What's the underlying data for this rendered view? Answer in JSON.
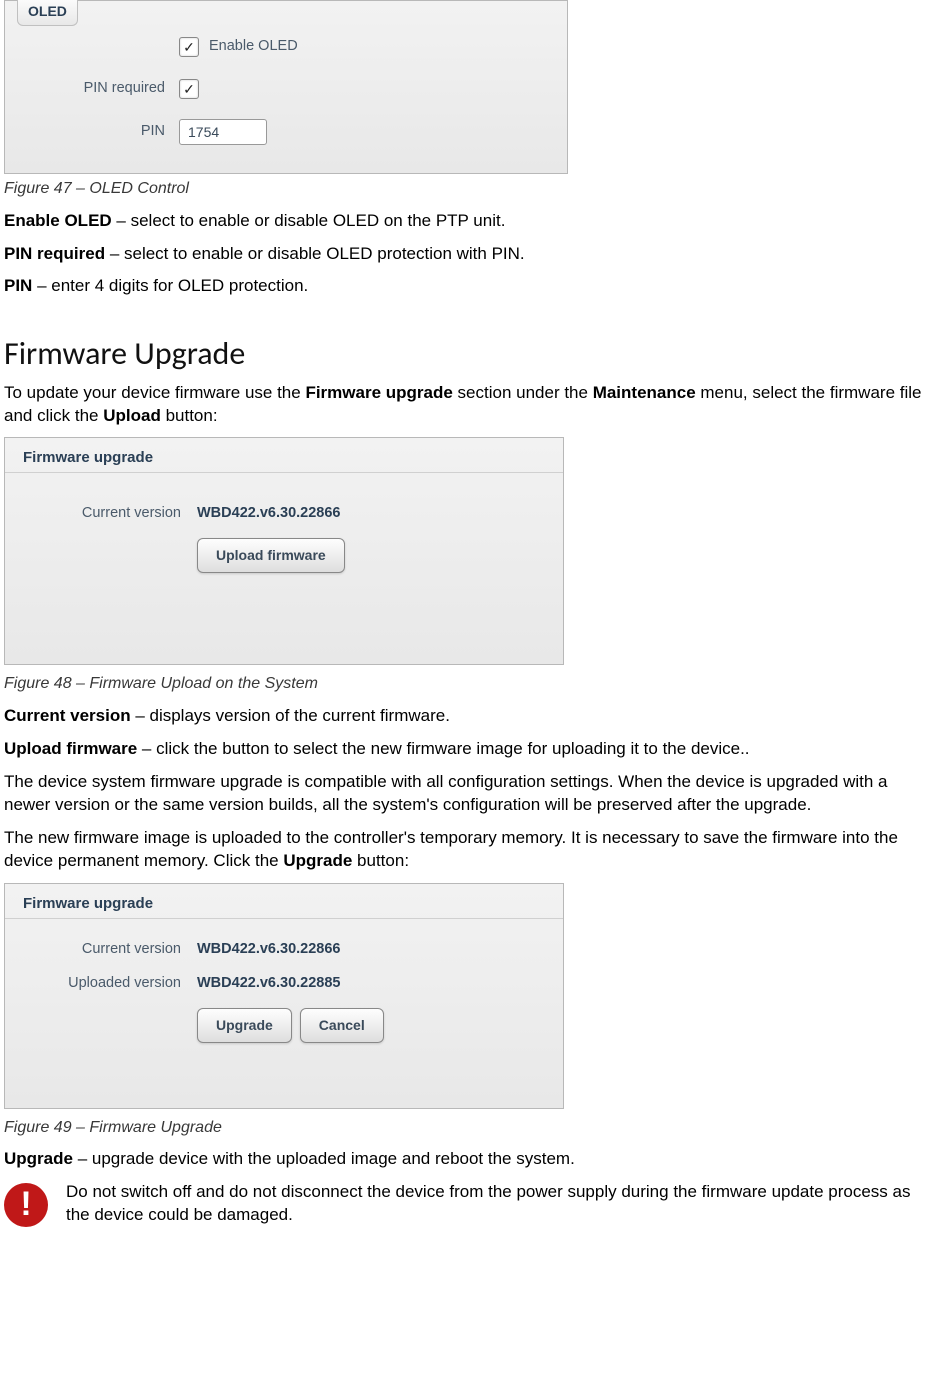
{
  "fig47": {
    "panel_title": "OLED",
    "enable_label": "Enable OLED",
    "pin_required_label": "PIN required",
    "pin_label": "PIN",
    "pin_value": "1754",
    "caption": "Figure 47 – OLED Control"
  },
  "def47": {
    "enable_bold": "Enable OLED",
    "enable_rest": " – select to enable or disable OLED on the PTP unit.",
    "pinreq_bold": "PIN required",
    "pinreq_rest": " – select to enable or disable OLED protection with PIN.",
    "pin_bold": "PIN",
    "pin_rest": " – enter 4 digits for OLED protection."
  },
  "heading_firmware": "Firmware Upgrade",
  "firmware_intro": {
    "t1": "To update your device firmware use the ",
    "b1": "Firmware upgrade",
    "t2": " section under the ",
    "b2": "Maintenance",
    "t3": " menu, select the firmware file and click the ",
    "b3": "Upload",
    "t4": " button:"
  },
  "fig48": {
    "panel_title": "Firmware upgrade",
    "current_label": "Current version",
    "current_value": "WBD422.v6.30.22866",
    "upload_button": "Upload firmware",
    "caption": "Figure 48 – Firmware Upload on the System"
  },
  "def48": {
    "cv_bold": "Current version",
    "cv_rest": " – displays version of the current firmware.",
    "uf_bold": "Upload firmware",
    "uf_rest": " – click the button to select the new firmware image for uploading it to the device..",
    "compat": "The device system firmware upgrade is compatible with all configuration settings. When the device is upgraded with a newer version or the same version builds, all the system's configuration will be preserved after the upgrade.",
    "temp_t1": "The new firmware image is uploaded to the controller's temporary memory. It is necessary to save the firmware into the device permanent memory. Click the ",
    "temp_b1": "Upgrade",
    "temp_t2": " button:"
  },
  "fig49": {
    "panel_title": "Firmware upgrade",
    "current_label": "Current version",
    "current_value": "WBD422.v6.30.22866",
    "uploaded_label": "Uploaded version",
    "uploaded_value": "WBD422.v6.30.22885",
    "upgrade_button": "Upgrade",
    "cancel_button": "Cancel",
    "caption": "Figure 49 – Firmware Upgrade"
  },
  "def49": {
    "up_bold": "Upgrade",
    "up_rest": " – upgrade device with the uploaded image and reboot the system."
  },
  "warning": {
    "text": "Do not switch off and do not disconnect the device from the power supply during the firmware update process as the device could be damaged."
  }
}
